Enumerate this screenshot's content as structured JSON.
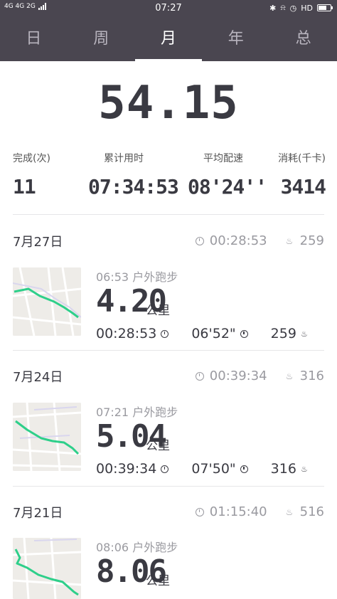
{
  "status": {
    "network": "4G 4G 2G",
    "time": "07:27",
    "hd": "HD"
  },
  "tabs": [
    {
      "label": "日",
      "active": false
    },
    {
      "label": "周",
      "active": false
    },
    {
      "label": "月",
      "active": true
    },
    {
      "label": "年",
      "active": false
    },
    {
      "label": "总",
      "active": false
    }
  ],
  "summary": {
    "total": "54.15",
    "stats": [
      {
        "label": "完成(次)",
        "value": "11"
      },
      {
        "label": "累计用时",
        "value": "07:34:53"
      },
      {
        "label": "平均配速",
        "value": "08'24''"
      },
      {
        "label": "消耗(千卡)",
        "value": "3414"
      }
    ]
  },
  "days": [
    {
      "date": "7月27日",
      "duration": "00:28:53",
      "calories": "259",
      "run": {
        "start": "06:53 户外跑步",
        "distance": "4.20",
        "unit": "公里",
        "duration": "00:28:53",
        "pace": "06'52\"",
        "calories": "259"
      }
    },
    {
      "date": "7月24日",
      "duration": "00:39:34",
      "calories": "316",
      "run": {
        "start": "07:21 户外跑步",
        "distance": "5.04",
        "unit": "公里",
        "duration": "00:39:34",
        "pace": "07'50\"",
        "calories": "316"
      }
    },
    {
      "date": "7月21日",
      "duration": "01:15:40",
      "calories": "516",
      "run": {
        "start": "08:06 户外跑步",
        "distance": "8.06",
        "unit": "公里"
      }
    }
  ],
  "colors": {
    "header": "#4a4650",
    "route": "#2ecf8a",
    "text": "#3a3a42"
  }
}
